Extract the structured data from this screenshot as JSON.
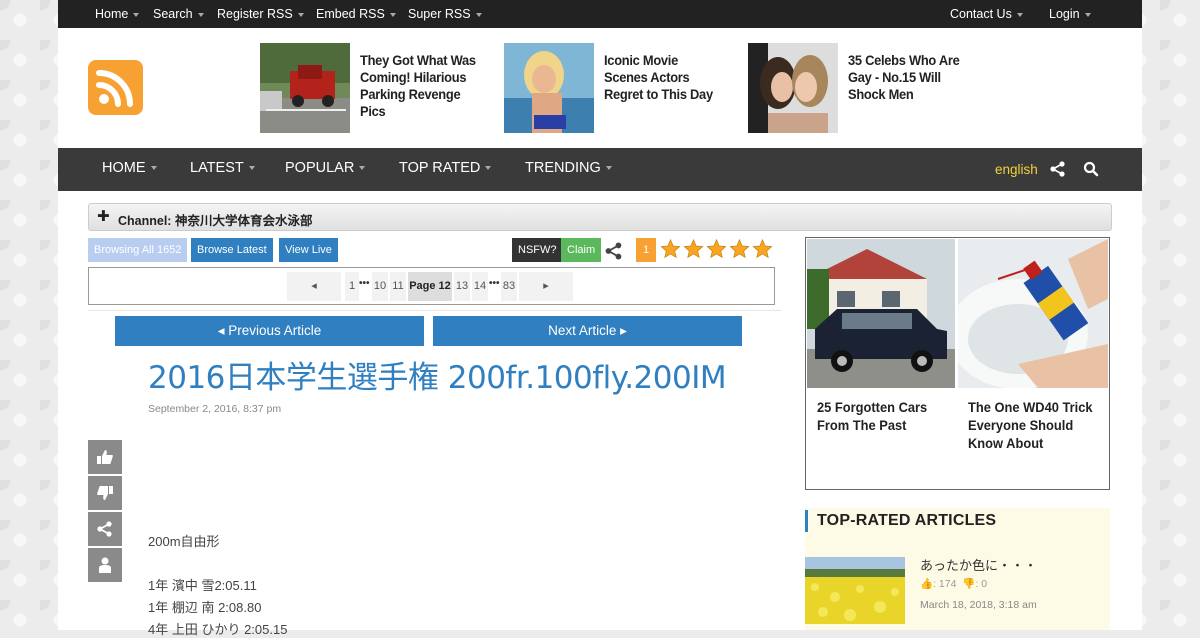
{
  "topbar": {
    "left": [
      "Home",
      "Search",
      "Register RSS",
      "Embed RSS",
      "Super RSS"
    ],
    "right": [
      "Contact Us",
      "Login"
    ]
  },
  "ads": [
    {
      "title": "They Got What Was Coming! Hilarious Parking Revenge Pics"
    },
    {
      "title": "Iconic Movie Scenes Actors Regret to This Day"
    },
    {
      "title": "35 Celebs Who Are Gay - No.15 Will Shock Men"
    }
  ],
  "mainnav": {
    "items": [
      "HOME",
      "LATEST",
      "POPULAR",
      "TOP RATED",
      "TRENDING"
    ],
    "language": "english"
  },
  "channel": {
    "label": "Channel: 神奈川大学体育会水泳部"
  },
  "actions": {
    "browsing_all": "Browsing All 1652",
    "browse_latest": "Browse Latest",
    "view_live": "View Live",
    "nsfw": "NSFW?",
    "claim": "Claim",
    "rating_count": "1",
    "rating_stars": 5
  },
  "pager": {
    "pages": [
      "1",
      "10",
      "11",
      "Page 12",
      "13",
      "14",
      "83"
    ],
    "dots": "•••"
  },
  "article_nav": {
    "prev": "Previous Article",
    "next": "Next Article"
  },
  "article": {
    "title": "2016日本学生選手権 200fr.100fly.200IM",
    "date": "September 2, 2016, 8:37 pm",
    "lines": [
      "200m自由形",
      "1年 濱中 雪2:05.11",
      "1年 棚辺 南 2:08.80",
      "4年 上田 ひかり 2:05.15"
    ]
  },
  "promo": [
    {
      "title": "25 Forgotten Cars From The Past"
    },
    {
      "title": "The One WD40 Trick Everyone Should Know About"
    }
  ],
  "top_rated": {
    "heading": "TOP-RATED ARTICLES",
    "items": [
      {
        "title": "あったか色に・・・",
        "likes": "174",
        "dislikes": "0",
        "date": "March 18, 2018, 3:18 am"
      }
    ]
  },
  "colors": {
    "accent": "#2f7fc1",
    "rss": "#f7a133",
    "star": "#f6a623"
  }
}
